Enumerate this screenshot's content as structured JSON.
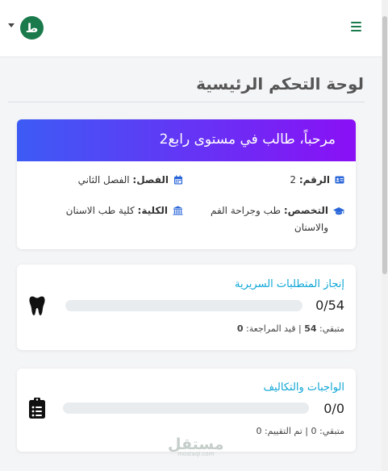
{
  "header": {
    "avatar_letter": "ط",
    "menu_icon": "hamburger-icon",
    "dropdown_icon": "caret-down-icon"
  },
  "page": {
    "title": "لوحة التحكم الرئيسية"
  },
  "welcome": {
    "heading": "مرحباً، طالب في مستوى رابع2",
    "gradient": [
      "#3d5bf5",
      "#8a10f5"
    ],
    "id_label": "الرقم:",
    "id_value": "2",
    "term_label": "الفصل:",
    "term_value": "الفصل الثاني",
    "major_label": "التخصص:",
    "major_value": "طب وجراحة الفم والاسنان",
    "college_label": "الكلية:",
    "college_value": "كلية طب الاسنان"
  },
  "stats": [
    {
      "title": "إنجاز المتطلبات السريرية",
      "value": "0/54",
      "progress": 0,
      "remaining_label": "متبقي:",
      "remaining": "54",
      "separator": "|",
      "second_label": "قيد المراجعة:",
      "second_value": "0",
      "icon": "tooth-icon"
    },
    {
      "title": "الواجبات والتكاليف",
      "value": "0/0",
      "progress": 0,
      "remaining_label": "متبقي:",
      "remaining": "0",
      "separator": "|",
      "second_label": "تم التقييم:",
      "second_value": "0",
      "icon": "clipboard-icon"
    }
  ],
  "watermark": {
    "text": "مستقل",
    "sub": "mostaql.com"
  },
  "colors": {
    "brand": "#1a7a4c",
    "accent_title": "#0fa7d6",
    "info_icon": "#2a66d9"
  }
}
